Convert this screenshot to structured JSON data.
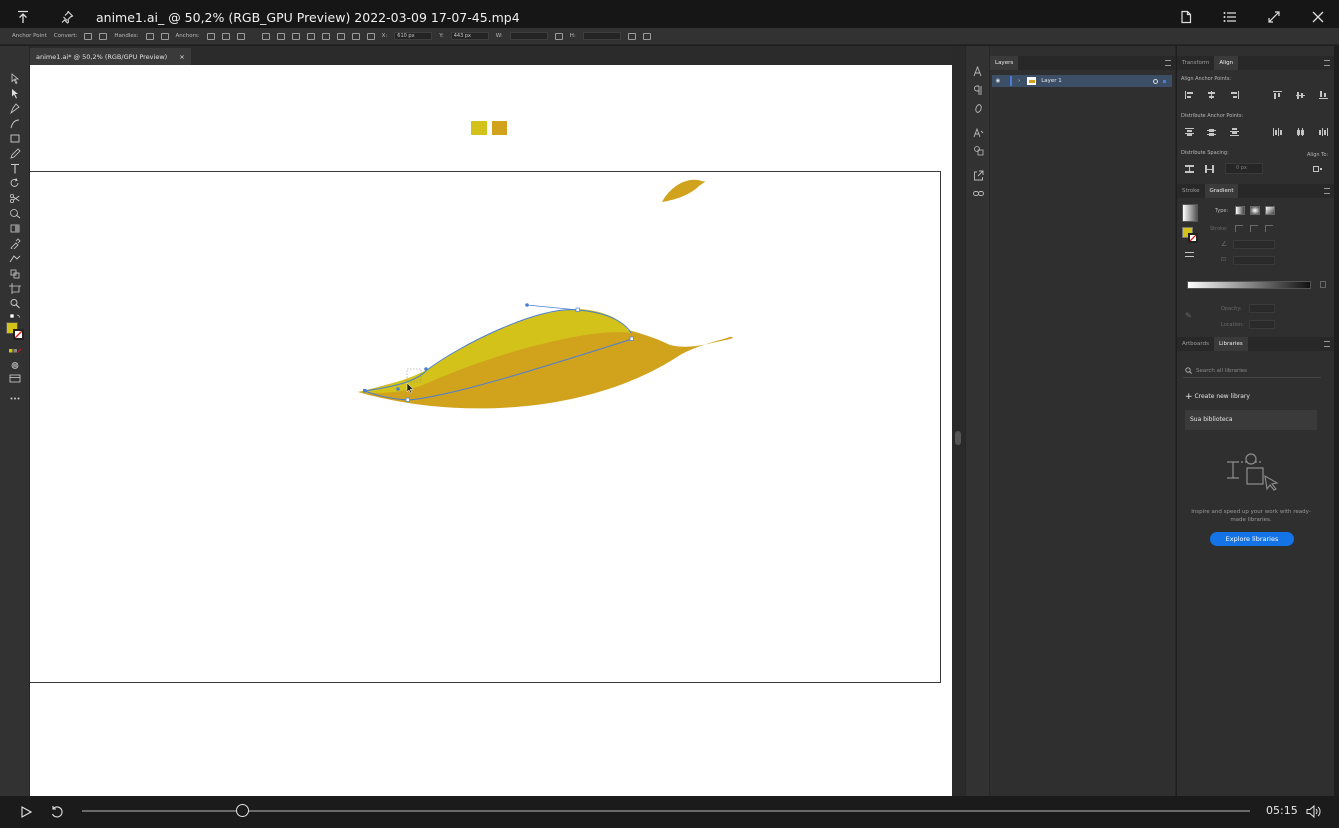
{
  "player": {
    "title": "anime1.ai_ @ 50,2% (RGB_GPU Preview)  2022-03-09 17-07-45.mp4",
    "time": "05:15",
    "progress": 0.137
  },
  "control_bar": {
    "anchor_point": "Anchor Point",
    "convert": "Convert:",
    "handles": "Handles:",
    "anchors": "Anchors:",
    "x_label": "X:",
    "x_value": "610 px",
    "y_label": "Y:",
    "y_value": "443 px",
    "w_label": "W:",
    "h_label": "H:"
  },
  "document": {
    "tab_title": "anime1.ai* @ 50,2% (RGB/GPU Preview)",
    "close": "×"
  },
  "colors": {
    "leaf_light": "#d2c21a",
    "leaf_dark": "#d1a21c",
    "selection": "#4a7fd6",
    "accent_button": "#1473e6"
  },
  "layers": {
    "tab": "Layers",
    "layer_name": "Layer 1"
  },
  "align": {
    "tab_transform": "Transform",
    "tab_align": "Align",
    "align_anchor_points": "Align Anchor Points:",
    "distribute_anchor_points": "Distribute Anchor Points:",
    "distribute_spacing": "Distribute Spacing:",
    "align_to": "Align To:",
    "spacing_value": "0 px"
  },
  "gradient": {
    "tab_stroke": "Stroke",
    "tab_gradient": "Gradient",
    "type": "Type:",
    "stroke": "Stroke:",
    "opacity": "Opacity:",
    "location": "Location:"
  },
  "libraries": {
    "tab_artboards": "Artboards",
    "tab_libraries": "Libraries",
    "search_placeholder": "Search all libraries",
    "create": "Create new library",
    "item": "Sua biblioteca",
    "inspire": "Inspire and speed up your work with ready-made libraries.",
    "explore": "Explore libraries"
  }
}
